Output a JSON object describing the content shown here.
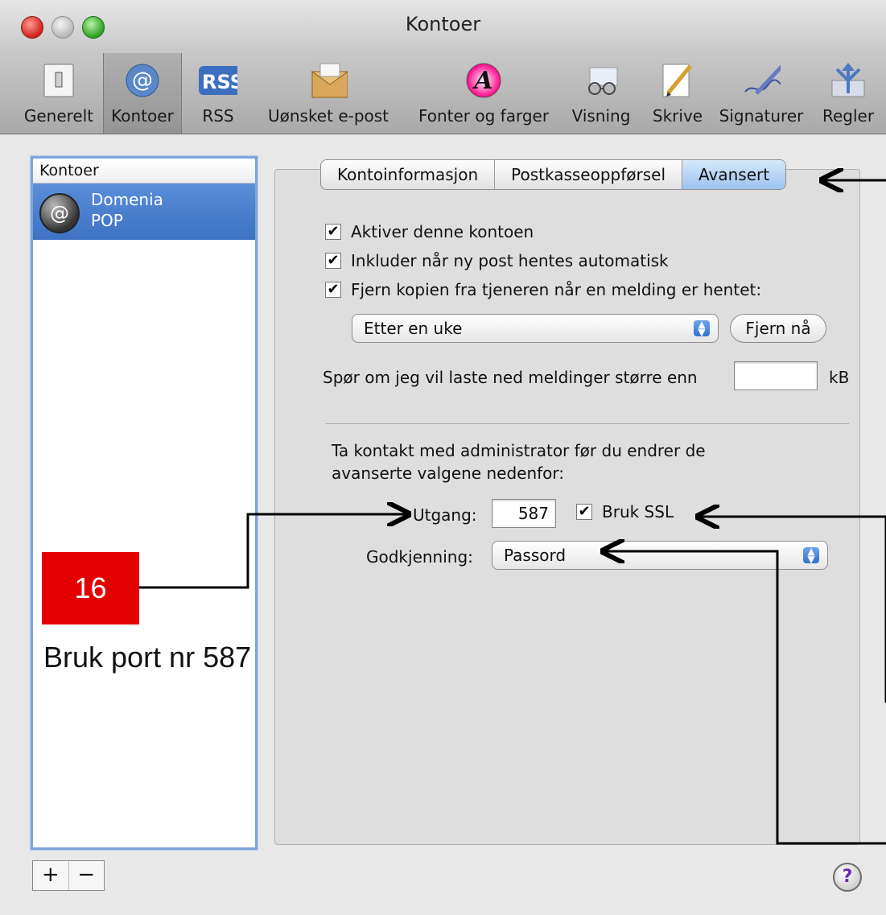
{
  "window": {
    "title": "Kontoer"
  },
  "toolbar": [
    {
      "label": "Generelt",
      "icon": "switch-icon"
    },
    {
      "label": "Kontoer",
      "icon": "at-sign-icon"
    },
    {
      "label": "RSS",
      "icon": "rss-icon"
    },
    {
      "label": "Uønsket e-post",
      "icon": "junk-mail-icon"
    },
    {
      "label": "Fonter og farger",
      "icon": "font-colors-icon"
    },
    {
      "label": "Visning",
      "icon": "viewing-glasses-icon"
    },
    {
      "label": "Skrive",
      "icon": "compose-pencil-icon"
    },
    {
      "label": "Signaturer",
      "icon": "signature-pen-icon"
    },
    {
      "label": "Regler",
      "icon": "rules-arrows-icon"
    }
  ],
  "accounts": {
    "header": "Kontoer",
    "items": [
      {
        "name": "Domenia",
        "type": "POP"
      }
    ],
    "add_label": "+",
    "remove_label": "−"
  },
  "tabs": [
    {
      "label": "Kontoinformasjon"
    },
    {
      "label": "Postkasseoppførsel"
    },
    {
      "label": "Avansert"
    }
  ],
  "advanced": {
    "enable": {
      "label": "Aktiver denne kontoen",
      "checked": true
    },
    "include": {
      "label": "Inkluder når ny post hentes automatisk",
      "checked": true
    },
    "remove_copy": {
      "label": "Fjern kopien fra tjeneren når en melding er hentet:",
      "checked": true
    },
    "remove_after": "Etter en uke",
    "remove_now": "Fjern nå",
    "large_msg_label": "Spør om jeg vil laste ned meldinger større enn",
    "large_msg_value": "",
    "large_msg_unit": "kB",
    "admin_note_1": "Ta kontakt med administrator før du endrer de",
    "admin_note_2": "avanserte valgene nedenfor:",
    "port_label": "Utgang:",
    "port_value": "587",
    "ssl": {
      "label": "Bruk SSL",
      "checked": true
    },
    "auth_label": "Godkjenning:",
    "auth_value": "Passord"
  },
  "annotation": {
    "number": "16",
    "text": "Bruk port nr 587",
    "color": "#e50000"
  },
  "help": "?",
  "check_glyph": "✔"
}
